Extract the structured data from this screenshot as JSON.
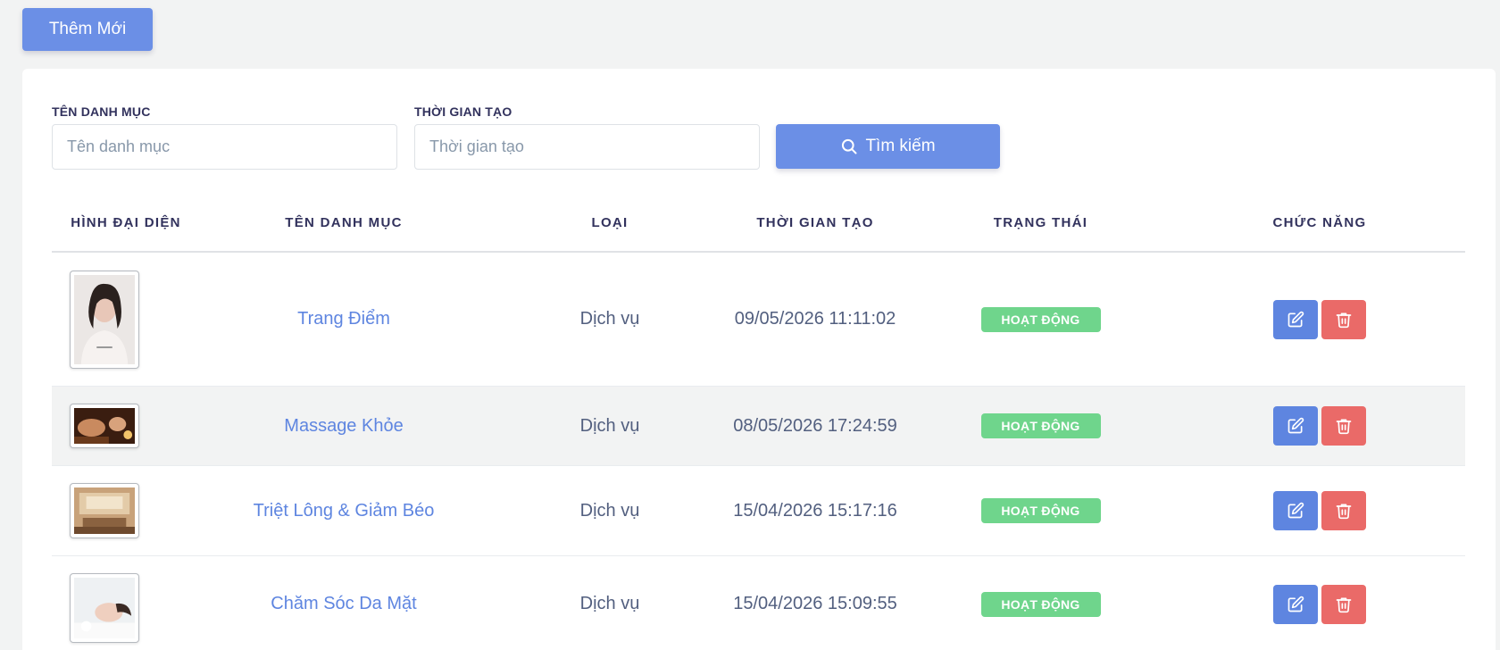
{
  "toolbar": {
    "add_label": "Thêm Mới"
  },
  "filters": {
    "name_label": "TÊN DANH MỤC",
    "name_placeholder": "Tên danh mục",
    "time_label": "THỜI GIAN TẠO",
    "time_placeholder": "Thời gian tạo",
    "search_label": "Tìm kiếm"
  },
  "table": {
    "headers": [
      "HÌNH ĐẠI DIỆN",
      "TÊN DANH MỤC",
      "LOẠI",
      "THỜI GIAN TẠO",
      "TRẠNG THÁI",
      "CHỨC NĂNG"
    ],
    "rows": [
      {
        "name": "Trang Điểm",
        "type": "Dịch vụ",
        "created": "09/05/2026 11:11:02",
        "status": "HOẠT ĐỘNG"
      },
      {
        "name": "Massage Khỏe",
        "type": "Dịch vụ",
        "created": "08/05/2026 17:24:59",
        "status": "HOẠT ĐỘNG"
      },
      {
        "name": "Triệt Lông & Giảm Béo",
        "type": "Dịch vụ",
        "created": "15/04/2026 15:17:16",
        "status": "HOẠT ĐỘNG"
      },
      {
        "name": "Chăm Sóc Da Mặt",
        "type": "Dịch vụ",
        "created": "15/04/2026 15:09:55",
        "status": "HOẠT ĐỘNG"
      }
    ]
  },
  "colors": {
    "primary": "#6b8fe6",
    "link": "#5e85e0",
    "success": "#6fd58c",
    "danger": "#ea6a68"
  }
}
